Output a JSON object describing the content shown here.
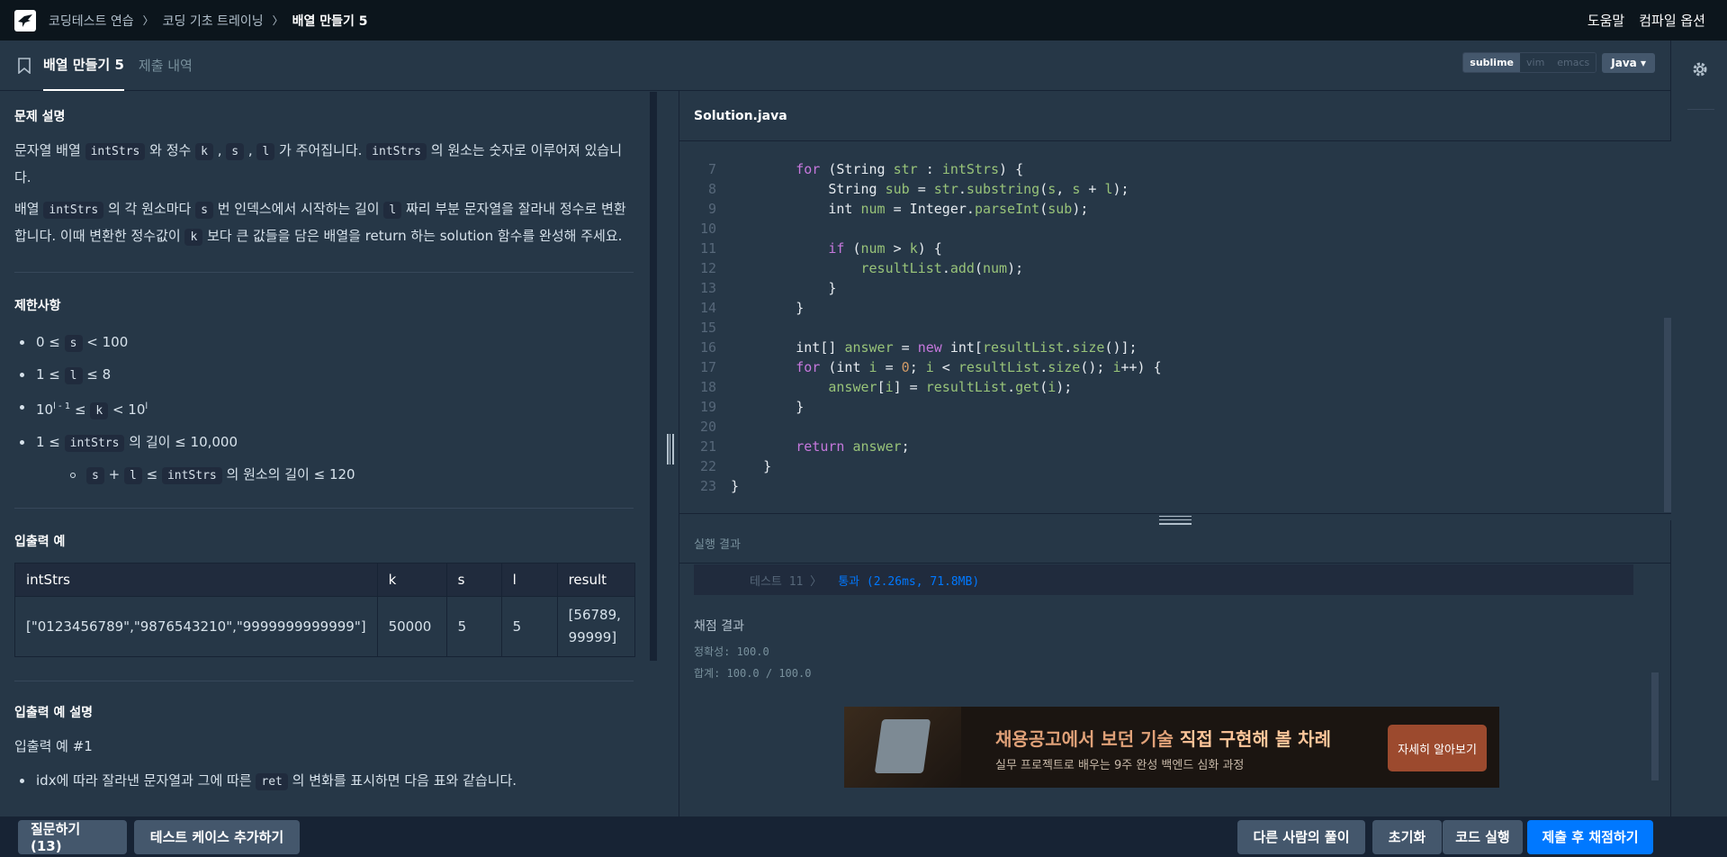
{
  "breadcrumb": {
    "items": [
      "코딩테스트 연습",
      "코딩 기초 트레이닝",
      "배열 만들기 5"
    ]
  },
  "header": {
    "help": "도움말",
    "compile_options": "컴파일 옵션"
  },
  "tabs": {
    "problem": "배열 만들기 5",
    "submissions": "제출 내역"
  },
  "editor_options": {
    "keys": [
      "sublime",
      "vim",
      "emacs"
    ],
    "language": "Java"
  },
  "problem": {
    "desc_title": "문제 설명",
    "p1_a": "문자열 배열",
    "p1_code1": "intStrs",
    "p1_b": "와 정수",
    "p1_code2": "k",
    "p1_c": ",",
    "p1_code3": "s",
    "p1_d": ",",
    "p1_code4": "l",
    "p1_e": "가 주어집니다.",
    "p1_code5": "intStrs",
    "p1_f": "의 원소는 숫자로 이루어져 있습니다.",
    "p2_a": "배열",
    "p2_code1": "intStrs",
    "p2_b": "의 각 원소마다",
    "p2_code2": "s",
    "p2_c": "번 인덱스에서 시작하는 길이",
    "p2_code3": "l",
    "p2_d": "짜리 부분 문자열을 잘라내 정수로 변환합니다. 이때 변환한 정수값이",
    "p2_code4": "k",
    "p2_e": "보다 큰 값들을 담은 배열을 return 하는 solution 함수를 완성해 주세요.",
    "constraints_title": "제한사항",
    "c1_a": "0 ≤",
    "c1_code": "s",
    "c1_b": "< 100",
    "c2_a": "1 ≤",
    "c2_code": "l",
    "c2_b": "≤ 8",
    "c3_a": "10",
    "c3_sup1": "l - 1",
    "c3_b": "≤",
    "c3_code": "k",
    "c3_c": "< 10",
    "c3_sup2": "l",
    "c4_a": "1 ≤",
    "c4_code": "intStrs",
    "c4_b": "의 길이 ≤ 10,000",
    "c5_code1": "s",
    "c5_a": "+",
    "c5_code2": "l",
    "c5_b": "≤",
    "c5_code3": "intStrs",
    "c5_c": "의 원소의 길이 ≤ 120",
    "io_title": "입출력 예",
    "io_headers": [
      "intStrs",
      "k",
      "s",
      "l",
      "result"
    ],
    "io_row": [
      "[\"0123456789\",\"9876543210\",\"9999999999999\"]",
      "50000",
      "5",
      "5",
      "[56789, 99999]"
    ],
    "io_desc_title": "입출력 예 설명",
    "io_ex1": "입출력 예 #1",
    "io_ex1_a": "idx에 따라 잘라낸 문자열과 그에 따른",
    "io_ex1_code": "ret",
    "io_ex1_b": "의 변화를 표시하면 다음 표와 같습니다."
  },
  "file": {
    "name": "Solution.java"
  },
  "code_lines": [
    {
      "n": "7"
    },
    {
      "n": "8"
    },
    {
      "n": "9"
    },
    {
      "n": "10"
    },
    {
      "n": "11"
    },
    {
      "n": "12"
    },
    {
      "n": "13"
    },
    {
      "n": "14"
    },
    {
      "n": "15"
    },
    {
      "n": "16"
    },
    {
      "n": "17"
    },
    {
      "n": "18"
    },
    {
      "n": "19"
    },
    {
      "n": "20"
    },
    {
      "n": "21"
    },
    {
      "n": "22"
    },
    {
      "n": "23"
    }
  ],
  "output": {
    "header": "실행 결과",
    "test_label": "테스트 11 〉",
    "test_result": "통과 (2.26ms, 71.8MB)",
    "grade_title": "채점 결과",
    "accuracy": "정확성: 100.0",
    "total": "합계: 100.0 / 100.0"
  },
  "banner": {
    "title_a": "채용공고에서 보던 기술 ",
    "title_b": "직접 구현해 볼 차례",
    "sub": "실무 프로젝트로 배우는 9주 완성 백엔드 심화 과정",
    "cta": "자세히 알아보기"
  },
  "bottom": {
    "ask": "질문하기 (13)",
    "add_testcase": "테스트 케이스 추가하기",
    "others": "다른 사람의 풀이",
    "reset": "초기화",
    "run": "코드 실행",
    "submit": "제출 후 채점하기"
  }
}
